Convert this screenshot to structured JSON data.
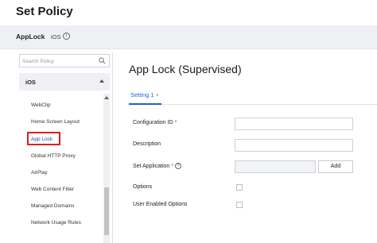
{
  "page": {
    "title": "Set Policy"
  },
  "subbar": {
    "app_name": "AppLock",
    "platform": "iOS",
    "info_glyph": "i"
  },
  "sidebar": {
    "search_placeholder": "Search Policy",
    "group_label": "iOS",
    "items": [
      {
        "label": "WebClip",
        "active": false
      },
      {
        "label": "Home Screen Layout",
        "active": false
      },
      {
        "label": "App Lock",
        "active": true
      },
      {
        "label": "Global HTTP Proxy",
        "active": false
      },
      {
        "label": "AirPlay",
        "active": false
      },
      {
        "label": "Web Content Filter",
        "active": false
      },
      {
        "label": "Managed Domains",
        "active": false
      },
      {
        "label": "Network Usage Rules",
        "active": false
      }
    ]
  },
  "main": {
    "heading": "App Lock (Supervised)",
    "tab": {
      "label": "Setting 1",
      "close_glyph": "×"
    },
    "form": {
      "configuration_id": {
        "label": "Configuration ID",
        "required_mark": "*",
        "value": ""
      },
      "description": {
        "label": "Description",
        "value": ""
      },
      "set_application": {
        "label": "Set Application",
        "required_mark": "*",
        "help_glyph": "?",
        "value": "",
        "add_label": "Add"
      },
      "options": {
        "label": "Options",
        "checked": false
      },
      "user_enabled_options": {
        "label": "User Enabled Options",
        "checked": false
      }
    }
  },
  "colors": {
    "accent": "#1a66c8",
    "highlight": "#e01e1e",
    "required": "#d62a2a",
    "subbar_bg": "#eef0f3"
  }
}
